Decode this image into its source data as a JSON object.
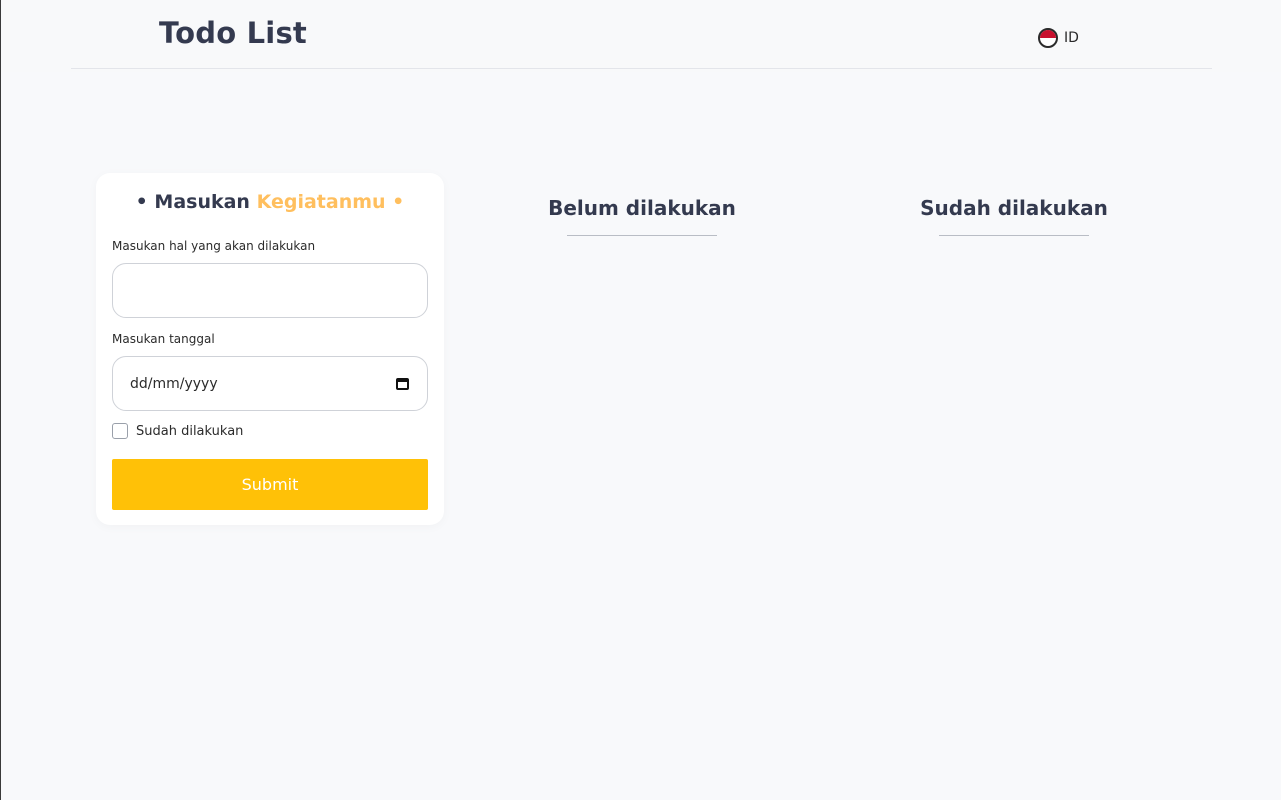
{
  "header": {
    "title": "Todo List",
    "language": {
      "code": "ID",
      "icon": "indonesia-flag-icon",
      "colors": [
        "#c8102e",
        "#ffffff"
      ]
    }
  },
  "form": {
    "title_prefix": "• Masukan",
    "title_accent": "Kegiatanmu •",
    "accent_color": "#ffbf5e",
    "task_label": "Masukan hal yang akan dilakukan",
    "task_value": "",
    "date_label": "Masukan tanggal",
    "date_placeholder": "dd/mm/yyyy",
    "date_icon": "calendar-icon",
    "done_checkbox_label": "Sudah dilakukan",
    "done_checked": false,
    "submit_label": "Submit",
    "submit_color": "#ffc107"
  },
  "columns": {
    "todo_title": "Belum dilakukan",
    "done_title": "Sudah dilakukan"
  }
}
